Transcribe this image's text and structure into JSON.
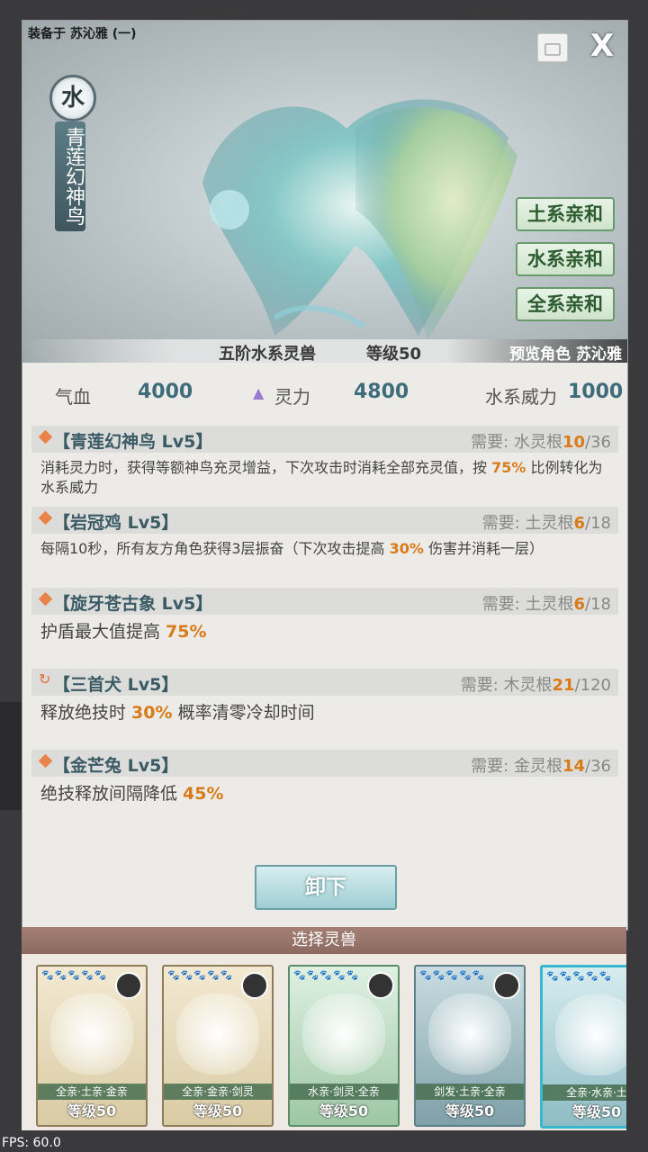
{
  "header": {
    "equipped_on": "装备于 苏沁雅 (一)",
    "close_label": "X",
    "lock_icon": "lock-icon"
  },
  "beast": {
    "element_char": "水",
    "name": "青莲幻神鸟",
    "rank": "五阶水系灵兽",
    "level": "等级50",
    "preview": "预览角色 苏沁雅"
  },
  "affinity_buttons": [
    "土系亲和",
    "水系亲和",
    "全系亲和"
  ],
  "stats": {
    "hp_label": "气血",
    "hp_value": "4000",
    "sp_label": "灵力",
    "sp_value": "4800",
    "power_label": "水系威力",
    "power_value": "1000"
  },
  "skills": [
    {
      "name": "【青莲幻神鸟 Lv5】",
      "req_label": "需要:",
      "req_root": "水灵根",
      "req_have": "10",
      "req_total": "/36",
      "desc_pre": "消耗灵力时，获得等额神鸟充灵增益，下次攻击时消耗全部充灵值，按 ",
      "desc_hl": "75%",
      "desc_post": " 比例转化为水系威力"
    },
    {
      "name": "【岩冠鸡 Lv5】",
      "req_label": "需要:",
      "req_root": "土灵根",
      "req_have": "6",
      "req_total": "/18",
      "desc_pre": "每隔10秒，所有友方角色获得3层振奋（下次攻击提高 ",
      "desc_hl": "30%",
      "desc_post": " 伤害并消耗一层）"
    },
    {
      "name": "【旋牙苍古象 Lv5】",
      "req_label": "需要:",
      "req_root": "土灵根",
      "req_have": "6",
      "req_total": "/18",
      "desc_pre": "护盾最大值提高 ",
      "desc_hl": "75%",
      "desc_post": ""
    },
    {
      "name": "【三首犬 Lv5】",
      "req_label": "需要:",
      "req_root": "木灵根",
      "req_have": "21",
      "req_total": "/120",
      "desc_pre": "释放绝技时 ",
      "desc_hl": "30%",
      "desc_post": " 概率清零冷却时间"
    },
    {
      "name": "【金芒兔 Lv5】",
      "req_label": "需要:",
      "req_root": "金灵根",
      "req_have": "14",
      "req_total": "/36",
      "desc_pre": "绝技释放间隔降低 ",
      "desc_hl": "45%",
      "desc_post": ""
    }
  ],
  "unload_label": "卸下",
  "select_title": "选择灵兽",
  "cards": [
    {
      "paws": "🐾🐾🐾🐾🐾",
      "tags": "全亲·土亲·金亲",
      "level": "等级50"
    },
    {
      "paws": "🐾🐾🐾🐾🐾",
      "tags": "全亲·金亲·剑灵",
      "level": "等级50"
    },
    {
      "paws": "🐾🐾🐾🐾🐾",
      "tags": "水亲·剑灵·全亲",
      "level": "等级50"
    },
    {
      "paws": "🐾🐾🐾🐾🐾",
      "tags": "剑发·土亲·全亲",
      "level": "等级50"
    },
    {
      "paws": "🐾🐾🐾🐾🐾",
      "tags": "全亲·水亲·土",
      "level": "等级50"
    }
  ],
  "fps": "FPS: 60.0"
}
